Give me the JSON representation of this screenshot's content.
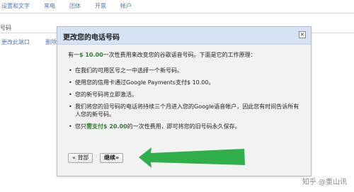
{
  "background": {
    "tabs": [
      "设置和文字",
      "来电",
      "团体",
      "开票",
      "帐户"
    ],
    "row1_label": "号码",
    "row2_link1": "更改此端口",
    "row2_link2": "删除"
  },
  "dialog": {
    "title": "更改您的电话号码",
    "close_icon": "close-x",
    "intro_before": "有一",
    "intro_fee": "$ 10.00",
    "intro_after": "一次性费用来改变您的谷歌语音号码。下面是它的工作原理：",
    "steps": [
      "在我们的可用区号之一中选择一个新号码。",
      "使用您的信用卡通过Google Payments支付$ 10.00。",
      "您的新号码将立即激活。",
      "我们将您的旧号码的电话将持续三个月进入您的Google语音帐户，因此您有时间告诉所有人您的新号码。"
    ],
    "last_before": "您只",
    "last_fee": "需支付$ 20.00",
    "last_after": "的一次性费用，即可将您的旧号码永久保存。",
    "back_label": "« 背部",
    "next_label": "继续»"
  },
  "watermark": "知乎 @重山讯",
  "colors": {
    "accent_green": "#2fae4a",
    "header_blue": "#d5e2f3"
  }
}
